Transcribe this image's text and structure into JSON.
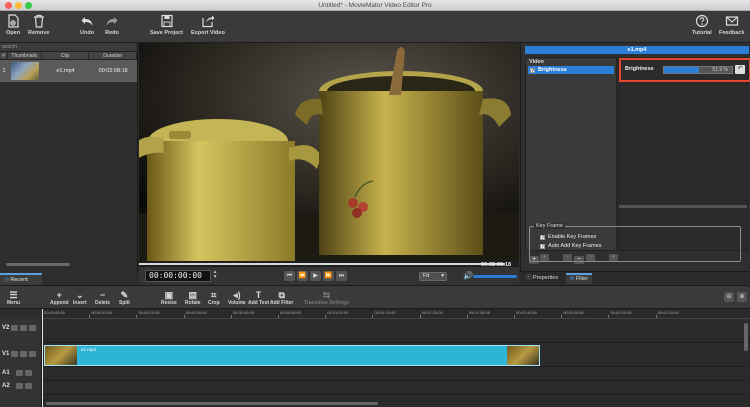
{
  "window": {
    "title": "Untitled* - MovieMator Video Editor Pro"
  },
  "toolbar": {
    "open": "Open",
    "remove": "Remove",
    "undo": "Undo",
    "redo": "Redo",
    "save_project": "Save Project",
    "export_video": "Export Video",
    "tutorial": "Tutorial",
    "feedback": "Feedback"
  },
  "media": {
    "search_placeholder": "search",
    "columns": [
      "#",
      "Thumbnails",
      "Clip",
      "Duration"
    ],
    "rows": [
      {
        "index": "1",
        "clip": "e1.mp4",
        "duration": "00:02:08:18"
      }
    ],
    "tab_label": "Recent"
  },
  "player": {
    "timecode": "00:00:00:00",
    "duration": "00:02:08:18",
    "zoom": "Fit",
    "volume_level": 1.0
  },
  "filter_panel": {
    "clip_name": "e1.mp4",
    "category": "Video",
    "filter_item": "Brightness",
    "param_label": "Brightness",
    "param_value_text": "51.9 %",
    "param_value": 0.519,
    "add_button": "+",
    "remove_button": "−",
    "keyframe_title": "Key Frame",
    "enable_keyframes": "Enable Key Frames",
    "auto_add_keyframes": "Auto Add Key Frames"
  },
  "right_tabs": {
    "properties": "Properties",
    "filter": "Filter"
  },
  "timeline_toolbar": {
    "menu": "Menu",
    "append": "Append",
    "insert": "Insert",
    "delete": "Delete",
    "split": "Split",
    "resize": "Resize",
    "rotate": "Rotate",
    "crop": "Crop",
    "volume": "Volume",
    "add_text": "Add Text",
    "add_filter": "Add Filter",
    "transition_settings": "Transition Settings"
  },
  "ruler_ticks": [
    "00:00:00:00",
    "00:00:10:00",
    "00:00:20:00",
    "00:00:30:00",
    "00:00:40:00",
    "00:00:50:00",
    "00:01:00:00",
    "00:01:10:00",
    "00:01:20:00",
    "00:01:30:00",
    "00:01:40:00",
    "00:01:50:00",
    "00:02:00:00",
    "00:02:10:00"
  ],
  "tracks": {
    "v2": "V2",
    "v1": "V1",
    "a1": "A1",
    "a2": "A2",
    "clip_label": "e1.mp4"
  },
  "colors": {
    "accent": "#2b7fd6",
    "clip": "#2db4d6",
    "highlight": "#e3492c"
  },
  "icons": [
    "open-icon",
    "trash-icon",
    "undo-icon",
    "redo-icon",
    "save-icon",
    "export-icon",
    "help-icon",
    "mail-icon"
  ]
}
